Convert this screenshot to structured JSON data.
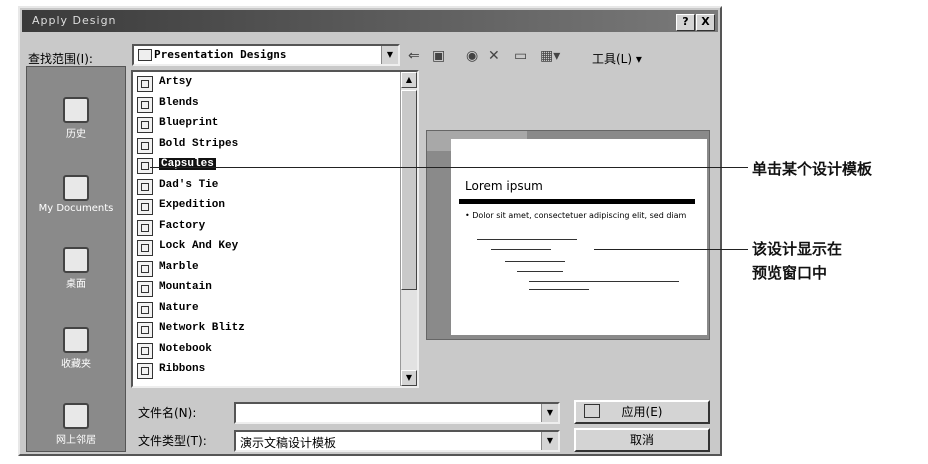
{
  "dialog": {
    "title": "Apply Design",
    "lookin_label": "查找范围(I):",
    "lookin_value": "Presentation Designs",
    "tools_label": "工具(L)",
    "help_btn": "?",
    "close_btn": "X"
  },
  "places": [
    {
      "label": "历史"
    },
    {
      "label": "My Documents"
    },
    {
      "label": "桌面"
    },
    {
      "label": "收藏夹"
    },
    {
      "label": "网上邻居"
    }
  ],
  "files": [
    {
      "name": "Artsy"
    },
    {
      "name": "Blends"
    },
    {
      "name": "Blueprint"
    },
    {
      "name": "Bold Stripes"
    },
    {
      "name": "Capsules"
    },
    {
      "name": "Dad's Tie"
    },
    {
      "name": "Expedition"
    },
    {
      "name": "Factory"
    },
    {
      "name": "Lock And Key"
    },
    {
      "name": "Marble"
    },
    {
      "name": "Mountain"
    },
    {
      "name": "Nature"
    },
    {
      "name": "Network Blitz"
    },
    {
      "name": "Notebook"
    },
    {
      "name": "Ribbons"
    }
  ],
  "selected_file": "Capsules",
  "preview": {
    "title": "Lorem ipsum",
    "bullet": "• Dolor sit amet, consectetuer adipiscing elit, sed diam"
  },
  "filename_label": "文件名(N):",
  "filename_value": "",
  "filetype_label": "文件类型(T):",
  "filetype_value": "演示文稿设计模板",
  "apply_button": "应用(E)",
  "cancel_button": "取消",
  "annotations": {
    "click_template": "单击某个设计模板",
    "preview_line1": "该设计显示在",
    "preview_line2": "预览窗口中"
  }
}
